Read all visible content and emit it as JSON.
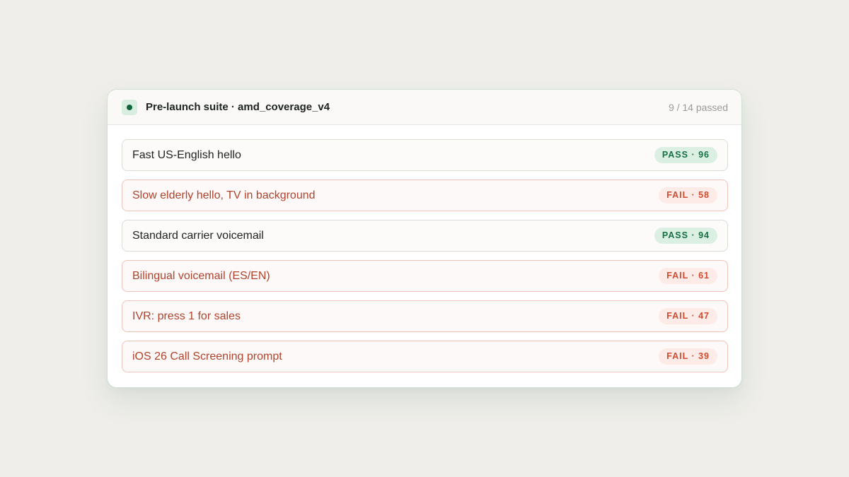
{
  "suite": {
    "title": "Pre-launch suite · amd_coverage_v4",
    "summary": "9 / 14 passed"
  },
  "colors": {
    "pass_badge_bg": "#dcefe3",
    "pass_badge_text": "#157043",
    "fail_badge_bg": "#fcebe6",
    "fail_badge_text": "#d04b30",
    "fail_text": "#b0432c",
    "status_dot": "#12643d"
  },
  "tests": [
    {
      "label": "Fast US-English hello",
      "status": "pass",
      "badge": "PASS · 96"
    },
    {
      "label": "Slow elderly hello, TV in background",
      "status": "fail",
      "badge": "FAIL · 58"
    },
    {
      "label": "Standard carrier voicemail",
      "status": "pass",
      "badge": "PASS · 94"
    },
    {
      "label": "Bilingual voicemail (ES/EN)",
      "status": "fail",
      "badge": "FAIL · 61"
    },
    {
      "label": "IVR: press 1 for sales",
      "status": "fail",
      "badge": "FAIL · 47"
    },
    {
      "label": "iOS 26 Call Screening prompt",
      "status": "fail",
      "badge": "FAIL · 39"
    }
  ]
}
